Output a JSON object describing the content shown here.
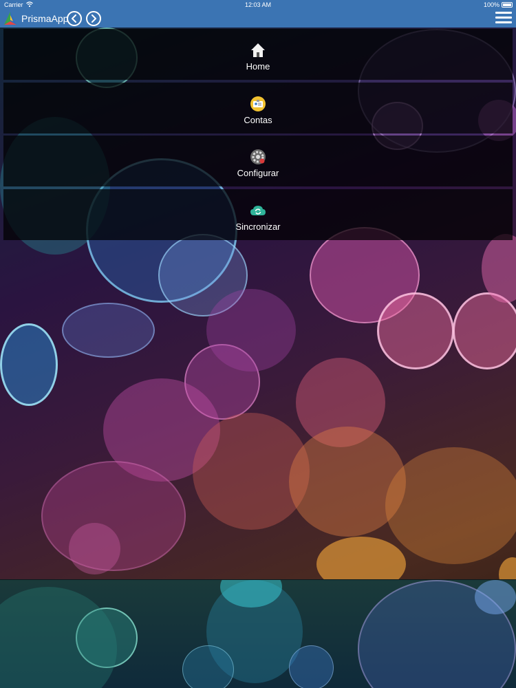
{
  "status_bar": {
    "carrier": "Carrier",
    "time": "12:03 AM",
    "battery": "100%"
  },
  "nav": {
    "title": "PrismaApp",
    "icons": {
      "logo": "prisma-logo-icon",
      "back": "chevron-left-icon",
      "forward": "chevron-right-icon",
      "menu": "hamburger-icon"
    }
  },
  "menu": {
    "items": [
      {
        "label": "Home",
        "icon": "home-icon"
      },
      {
        "label": "Contas",
        "icon": "id-card-icon"
      },
      {
        "label": "Configurar",
        "icon": "gear-icon"
      },
      {
        "label": "Sincronizar",
        "icon": "cloud-sync-icon"
      }
    ]
  },
  "colors": {
    "nav_bar": "#3b74b3",
    "menu_item_bg": "rgba(0,0,0,0.72)",
    "text": "#ffffff"
  }
}
